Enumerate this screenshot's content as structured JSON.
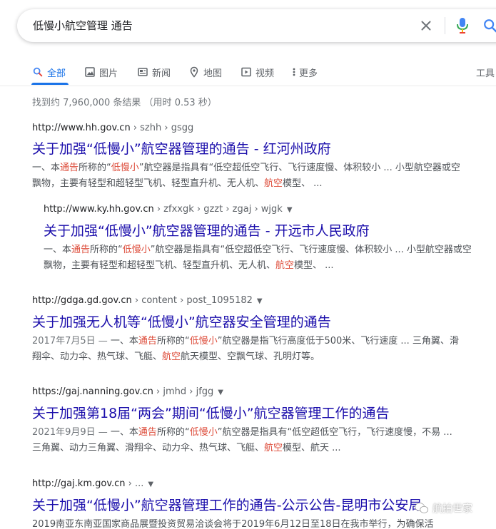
{
  "search": {
    "query": "低慢小航空管理 通告"
  },
  "tabs": [
    {
      "label": "全部",
      "icon": "search-icon"
    },
    {
      "label": "图片",
      "icon": "image-icon"
    },
    {
      "label": "新闻",
      "icon": "news-icon"
    },
    {
      "label": "地图",
      "icon": "map-pin-icon"
    },
    {
      "label": "视频",
      "icon": "video-icon"
    },
    {
      "label": "更多",
      "icon": "more-vert-icon"
    }
  ],
  "tools_label": "工具",
  "stats": "找到约 7,960,000 条结果  （用时 0.53 秒）",
  "results": [
    {
      "cite_host": "http://www.hh.gov.cn",
      "cite_path": " › szhh › gsgg",
      "title": "关于加强“低慢小”航空器管理的通告 - 红河州政府",
      "snippet": [
        {
          "t": "一、本",
          "h": false
        },
        {
          "t": "通告",
          "h": true
        },
        {
          "t": "所称的“",
          "h": false
        },
        {
          "t": "低慢小",
          "h": true
        },
        {
          "t": "”航空器是指具有“低空超低空飞行、飞行速度慢、体积较小 ... 小型航空器或空飘物，主要有轻型和超轻型飞机、轻型直升机、无人机、",
          "h": false
        },
        {
          "t": "航空",
          "h": true
        },
        {
          "t": "模型、 ...",
          "h": false
        }
      ]
    },
    {
      "cite_host": "http://www.ky.hh.gov.cn",
      "cite_path": " › zfxxgk › gzzt › zgaj › wjgk",
      "title": "关于加强“低慢小”航空器管理的通告 - 开远市人民政府",
      "snippet": [
        {
          "t": "一、本",
          "h": false
        },
        {
          "t": "通告",
          "h": true
        },
        {
          "t": "所称的“",
          "h": false
        },
        {
          "t": "低慢小",
          "h": true
        },
        {
          "t": "”航空器是指具有“低空超低空飞行、飞行速度慢、体积较小 ... 小型航空器或空飘物，主要有轻型和超轻型飞机、轻型直升机、无人机、",
          "h": false
        },
        {
          "t": "航空",
          "h": true
        },
        {
          "t": "模型、 ...",
          "h": false
        }
      ]
    },
    {
      "cite_host": "http://gdga.gd.gov.cn",
      "cite_path": " › content › post_1095182",
      "title": "关于加强无人机等“低慢小”航空器安全管理的通告",
      "date": "2017年7月5日 — ",
      "snippet": [
        {
          "t": "一、本",
          "h": false
        },
        {
          "t": "通告",
          "h": true
        },
        {
          "t": "所称的“",
          "h": false
        },
        {
          "t": "低慢小",
          "h": true
        },
        {
          "t": "”航空器是指飞行高度低于500米、飞行速度 ... 三角翼、滑翔伞、动力伞、热气球、飞艇、",
          "h": false
        },
        {
          "t": "航空",
          "h": true
        },
        {
          "t": "航天模型、空飘气球、孔明灯等。",
          "h": false
        }
      ]
    },
    {
      "cite_host": "https://gaj.nanning.gov.cn",
      "cite_path": " › jmhd › jfgg",
      "title": "关于加强第18届“两会”期间“低慢小”航空器管理工作的通告",
      "date": "2021年9月9日 — ",
      "snippet": [
        {
          "t": "一、本",
          "h": false
        },
        {
          "t": "通告",
          "h": true
        },
        {
          "t": "所称的“",
          "h": false
        },
        {
          "t": "低慢小",
          "h": true
        },
        {
          "t": "”航空器是指具有“低空超低空飞行，飞行速度慢，不易 ... 三角翼、动力三角翼、滑翔伞、动力伞、热气球、飞艇、",
          "h": false
        },
        {
          "t": "航空",
          "h": true
        },
        {
          "t": "模型、航天 ...",
          "h": false
        }
      ]
    },
    {
      "cite_host": "http://gaj.km.gov.cn",
      "cite_path": " › ...",
      "title": "关于加强“低慢小”航空器管理工作的通告-公示公告-昆明市公安局",
      "snippet": [
        {
          "t": "2019南亚东南亚国家商品展暨投资贸易洽谈会将于2019年6月12日至18日在我市举行，为确保活",
          "h": false
        }
      ]
    }
  ],
  "watermark": "航拍世家",
  "colors": {
    "link": "#1a0dab",
    "accent": "#1a73e8",
    "highlight": "#dd4b39"
  }
}
